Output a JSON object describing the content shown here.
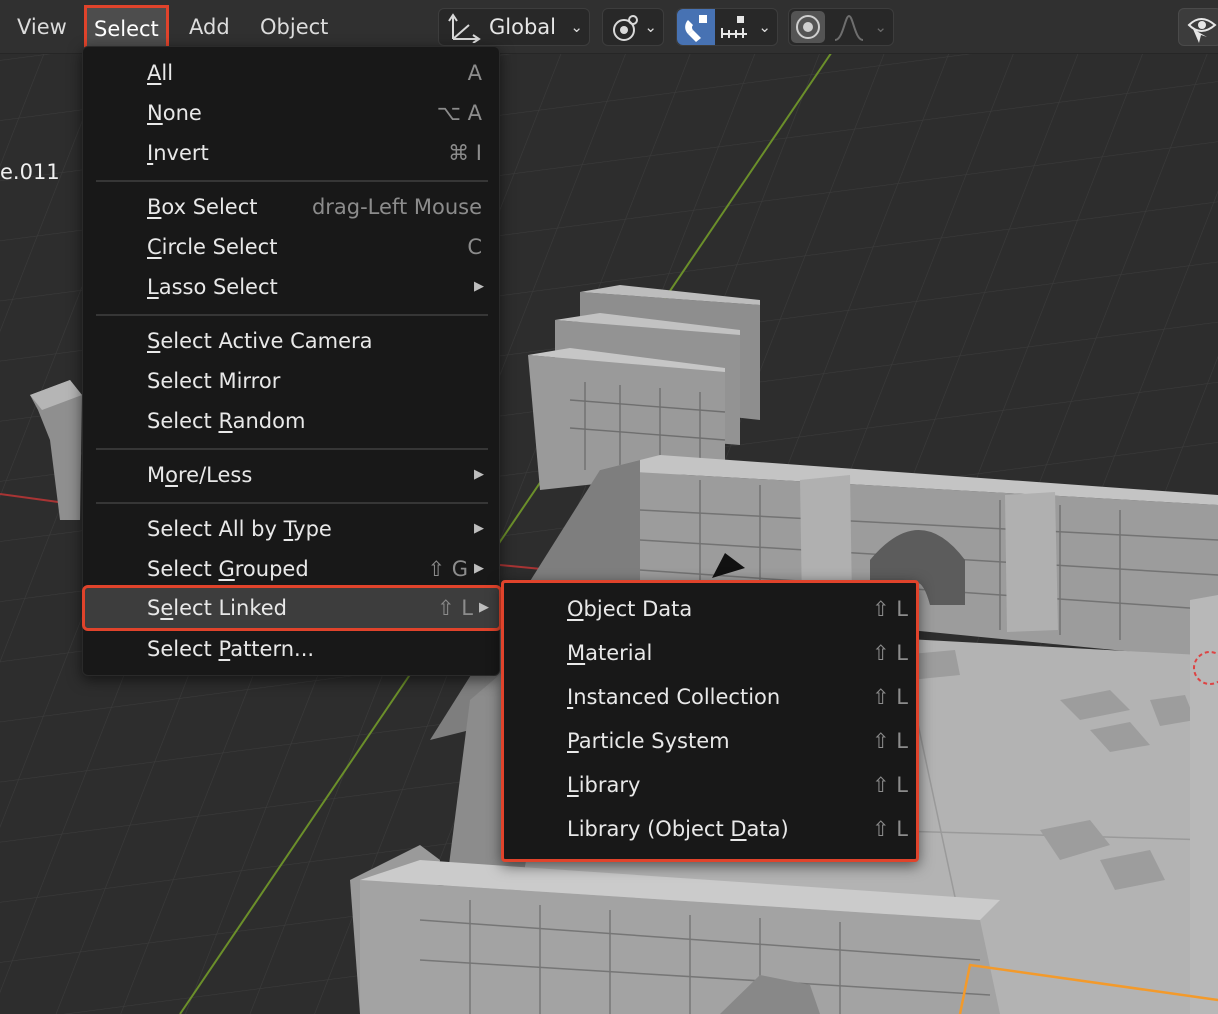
{
  "header": {
    "menus": [
      "View",
      "Select",
      "Add",
      "Object"
    ],
    "orientation": "Global"
  },
  "viewport": {
    "object_label": "e.011",
    "accent_highlight": "#e0432b",
    "selection_outline": "#f39a2b"
  },
  "select_menu": {
    "items": [
      {
        "label": "All",
        "u": "A",
        "shortcut": "A"
      },
      {
        "label": "None",
        "u": "N",
        "shortcut": "⌥ A"
      },
      {
        "label": "Invert",
        "u": "I",
        "shortcut": "⌘ I"
      },
      {
        "label": "Box Select",
        "u": "B",
        "shortcut": "drag‑Left Mouse"
      },
      {
        "label": "Circle Select",
        "u": "C",
        "shortcut": "C"
      },
      {
        "label": "Lasso Select",
        "u": "L",
        "shortcut": ""
      },
      {
        "label": "Select Active Camera",
        "u": "S",
        "shortcut": ""
      },
      {
        "label": "Select Mirror",
        "u": "",
        "shortcut": ""
      },
      {
        "label": "Select Random",
        "u": "R",
        "shortcut": ""
      },
      {
        "label": "More/Less",
        "u": "o",
        "shortcut": ""
      },
      {
        "label": "Select All by Type",
        "u": "T",
        "shortcut": ""
      },
      {
        "label": "Select Grouped",
        "u": "G",
        "shortcut": "⇧ G"
      },
      {
        "label": "Select Linked",
        "u": "e",
        "shortcut": "⇧ L"
      },
      {
        "label": "Select Pattern...",
        "u": "P",
        "shortcut": ""
      }
    ]
  },
  "linked_menu": {
    "items": [
      {
        "label": "Object Data",
        "u": "O",
        "shortcut": "⇧ L"
      },
      {
        "label": "Material",
        "u": "M",
        "shortcut": "⇧ L"
      },
      {
        "label": "Instanced Collection",
        "u": "I",
        "shortcut": "⇧ L"
      },
      {
        "label": "Particle System",
        "u": "P",
        "shortcut": "⇧ L"
      },
      {
        "label": "Library",
        "u": "L",
        "shortcut": "⇧ L"
      },
      {
        "label": "Library (Object Data)",
        "u": "D",
        "shortcut": "⇧ L"
      }
    ]
  },
  "icons": [
    "orientation-axes-icon",
    "pivot-point-icon",
    "snap-magnet-icon",
    "snap-increment-icon",
    "proportional-edit-icon",
    "falloff-curve-icon",
    "visibility-eye-icon"
  ]
}
